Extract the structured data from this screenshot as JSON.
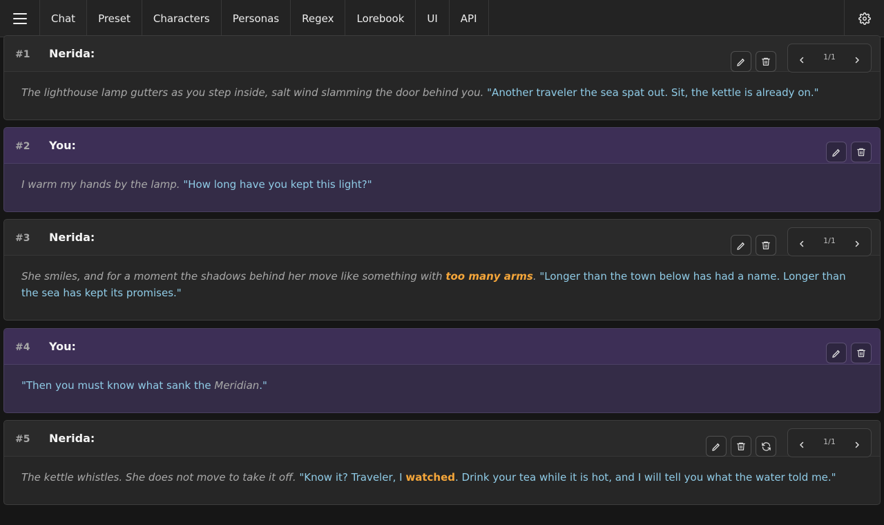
{
  "nav": {
    "menu_icon": "hamburger-icon",
    "tabs": [
      {
        "label": "Chat",
        "active": true
      },
      {
        "label": "Preset"
      },
      {
        "label": "Characters"
      },
      {
        "label": "Personas"
      },
      {
        "label": "Regex"
      },
      {
        "label": "Lorebook"
      },
      {
        "label": "UI"
      },
      {
        "label": "API"
      }
    ],
    "settings_icon": "gear-icon"
  },
  "colors": {
    "accent": "#7a4fd8",
    "quote": "#8fcbe6",
    "narration": "#a9a9a9",
    "highlight": "#f5a63a",
    "user_bg": "#342c47",
    "char_bg": "#262626"
  },
  "messages": [
    {
      "num": "#1",
      "name": "Nerida:",
      "role": "character",
      "swipe": "1/1",
      "narration": "The lighthouse lamp gutters as you step inside, salt wind slamming the door behind you.",
      "quote": "\"Another traveler the sea spat out. Sit, the kettle is already on.\""
    },
    {
      "num": "#2",
      "name": "You:",
      "role": "user",
      "narration": "I warm my hands by the lamp.",
      "quote": "\"How long have you kept this light?\""
    },
    {
      "num": "#3",
      "name": "Nerida:",
      "role": "character",
      "swipe": "1/1",
      "narration": "She smiles, and for a moment the shadows behind her move like something with",
      "emphasis": "too many arms",
      "narration_end": ".",
      "quote": "\"Longer than the town below has had a name. Longer than the sea has kept its promises.\""
    },
    {
      "num": "#4",
      "name": "You:",
      "role": "user",
      "quote_start": "\"Then you must know what sank the",
      "italic_word": "Meridian",
      "quote_end": ".\""
    },
    {
      "num": "#5",
      "name": "Nerida:",
      "role": "character",
      "swipe": "1/1",
      "narration": "The kettle whistles. She does not move to take it off.",
      "quote_start": "\"Know it? Traveler, I",
      "highlight": "watched",
      "quote_end": ". Drink your tea while it is hot, and I will tell you what the water told me.\""
    }
  ]
}
